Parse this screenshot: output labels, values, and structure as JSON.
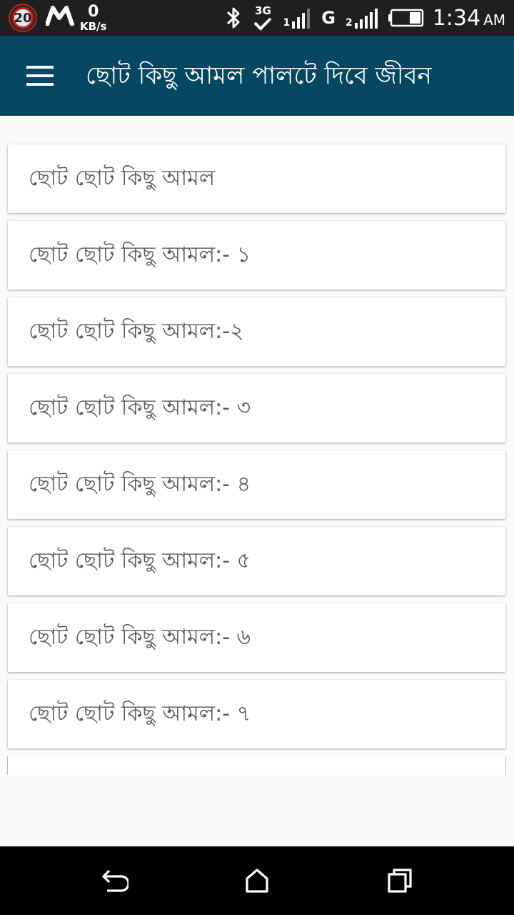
{
  "status_bar": {
    "notification_count": "20",
    "speed_value": "0",
    "speed_unit": "KB/s",
    "network_type": "3G",
    "signal_g": "G",
    "sim2_label": "2",
    "sim1_label": "1",
    "time": "1:34",
    "ampm": "AM",
    "icons": [
      "notification-badge",
      "m-app-logo",
      "bluetooth-icon",
      "data-3g-icon",
      "signal-sim1-icon",
      "signal-sim2-icon",
      "battery-icon"
    ]
  },
  "app_bar": {
    "title": "ছোট কিছু আমল পালটে দিবে জীবন",
    "background_color": "#064861",
    "menu_icon": "hamburger-menu-icon"
  },
  "list": {
    "items": [
      {
        "label": "ছোট ছোট কিছু আমল"
      },
      {
        "label": "ছোট ছোট কিছু আমল:- ১"
      },
      {
        "label": "ছোট ছোট কিছু আমল:-২"
      },
      {
        "label": "ছোট ছোট কিছু আমল:- ৩"
      },
      {
        "label": "ছোট ছোট কিছু আমল:- ৪"
      },
      {
        "label": "ছোট ছোট কিছু আমল:- ৫"
      },
      {
        "label": "ছোট ছোট কিছু আমল:- ৬"
      },
      {
        "label": "ছোট ছোট কিছু আমল:- ৭"
      }
    ]
  },
  "nav_bar": {
    "buttons": [
      "back-icon",
      "home-icon",
      "recents-icon"
    ]
  }
}
